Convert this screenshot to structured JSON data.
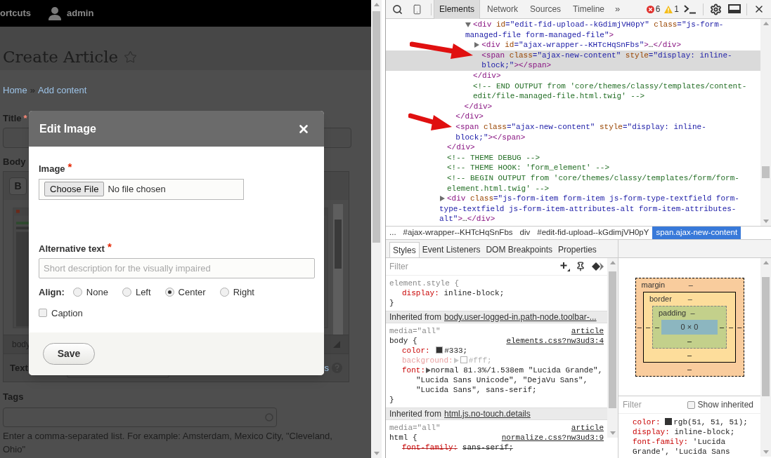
{
  "page": {
    "toolbar": {
      "shortcuts_label": "ortcuts",
      "user_name": "admin"
    },
    "title": "Create Article",
    "favorite": false,
    "breadcrumb": [
      {
        "label": "Home"
      },
      {
        "label": "Add content"
      }
    ],
    "breadcrumb_separator": "»",
    "title_field": {
      "label": "Title",
      "required_mark": "*"
    },
    "body_label": "Body",
    "editor": {
      "bold_button": "B",
      "path": "body"
    },
    "text_format": {
      "label": "Text",
      "link": "s"
    },
    "tags": {
      "label": "Tags",
      "help": "Enter a comma-separated list. For example: Amsterdam, Mexico City, \"Cleveland, Ohio\""
    }
  },
  "dialog": {
    "title": "Edit Image",
    "image": {
      "label": "Image",
      "required_mark": "*",
      "button": "Choose File",
      "status": "No file chosen"
    },
    "alt": {
      "label": "Alternative text",
      "required_mark": "*",
      "placeholder": "Short description for the visually impaired"
    },
    "align": {
      "label": "Align:",
      "options": [
        {
          "label": "None",
          "selected": false
        },
        {
          "label": "Left",
          "selected": false
        },
        {
          "label": "Center",
          "selected": true
        },
        {
          "label": "Right",
          "selected": false
        }
      ]
    },
    "caption": {
      "label": "Caption",
      "checked": false
    },
    "save": "Save"
  },
  "devtools": {
    "tabs": [
      {
        "label": "Elements",
        "selected": true
      },
      {
        "label": "Network",
        "selected": false
      },
      {
        "label": "Sources",
        "selected": false
      },
      {
        "label": "Timeline",
        "selected": false
      }
    ],
    "more": "»",
    "errors": "6",
    "warnings": "1",
    "dom_tree": [
      {
        "selected": false,
        "closing": [
          {
            "kind": "tag",
            "text": "</div>"
          }
        ],
        "children": [
          {
            "selected": false,
            "closing": [
              {
                "kind": "tag",
                "text": "</div>"
              }
            ],
            "children": [
              {
                "selected": false,
                "closing": [
                  {
                    "kind": "tag",
                    "text": "</div>"
                  }
                ],
                "children": [
                  {
                    "selected": false,
                    "expanded": true,
                    "lines": [
                      [
                        {
                          "kind": "tag",
                          "text": "<div"
                        },
                        {
                          "kind": "attr",
                          "text": " id"
                        },
                        {
                          "kind": "value",
                          "text": "=\"edit-fid-upload--kGdimjVH0pY\""
                        },
                        {
                          "kind": "attr",
                          "text": " class"
                        },
                        {
                          "kind": "value",
                          "text": "=\"js-form-"
                        }
                      ],
                      [
                        {
                          "kind": "value",
                          "text": "managed-file form-managed-file\""
                        },
                        {
                          "kind": "tag",
                          "text": ">"
                        }
                      ]
                    ],
                    "closing": [
                      {
                        "kind": "tag",
                        "text": "</div>"
                      }
                    ],
                    "children": [
                      {
                        "selected": false,
                        "expanded": false,
                        "lines": [
                          [
                            {
                              "kind": "tag",
                              "text": "<div"
                            },
                            {
                              "kind": "attr",
                              "text": " id"
                            },
                            {
                              "kind": "value",
                              "text": "=\"ajax-wrapper--KHTcHqSnFbs\""
                            },
                            {
                              "kind": "tag",
                              "text": ">"
                            },
                            {
                              "kind": "text",
                              "text": "…"
                            },
                            {
                              "kind": "tag",
                              "text": "</div>"
                            }
                          ]
                        ]
                      },
                      {
                        "selected": true,
                        "lines": [
                          [
                            {
                              "kind": "tag",
                              "text": "<span"
                            },
                            {
                              "kind": "attr",
                              "text": " class"
                            },
                            {
                              "kind": "value",
                              "text": "=\"ajax-new-content\""
                            },
                            {
                              "kind": "attr",
                              "text": " style"
                            },
                            {
                              "kind": "value",
                              "text": "=\"display: inline-"
                            }
                          ],
                          [
                            {
                              "kind": "value",
                              "text": "block;\""
                            },
                            {
                              "kind": "tag",
                              "text": "></span>"
                            }
                          ]
                        ]
                      }
                    ]
                  },
                  {
                    "selected": false,
                    "lines": [
                      [
                        {
                          "kind": "comment",
                          "text": "<!-- END OUTPUT from 'core/themes/classy/templates/content-"
                        }
                      ],
                      [
                        {
                          "kind": "comment",
                          "text": "edit/file-managed-file.html.twig' -->"
                        }
                      ]
                    ]
                  }
                ]
              }
            ]
          },
          {
            "selected": false,
            "lines": [
              [
                {
                  "kind": "tag",
                  "text": "<span"
                },
                {
                  "kind": "attr",
                  "text": " class"
                },
                {
                  "kind": "value",
                  "text": "=\"ajax-new-content\""
                },
                {
                  "kind": "attr",
                  "text": " style"
                },
                {
                  "kind": "value",
                  "text": "=\"display: inline-"
                }
              ],
              [
                {
                  "kind": "value",
                  "text": "block;\""
                },
                {
                  "kind": "tag",
                  "text": "></span>"
                }
              ]
            ]
          }
        ]
      },
      {
        "selected": false,
        "lines": [
          [
            {
              "kind": "comment",
              "text": "<!-- THEME DEBUG -->"
            }
          ]
        ]
      },
      {
        "selected": false,
        "lines": [
          [
            {
              "kind": "comment",
              "text": "<!-- THEME HOOK: 'form_element' -->"
            }
          ]
        ]
      },
      {
        "selected": false,
        "lines": [
          [
            {
              "kind": "comment",
              "text": "<!-- BEGIN OUTPUT from 'core/themes/classy/templates/form/form-"
            }
          ],
          [
            {
              "kind": "comment",
              "text": "element.html.twig' -->"
            }
          ]
        ]
      },
      {
        "selected": false,
        "expanded": false,
        "lines": [
          [
            {
              "kind": "tag",
              "text": "<div"
            },
            {
              "kind": "attr",
              "text": " class"
            },
            {
              "kind": "value",
              "text": "=\"js-form-item form-item js-form-type-textfield form-"
            }
          ],
          [
            {
              "kind": "value",
              "text": "type-textfield js-form-item-attributes-alt form-item-attributes-"
            }
          ],
          [
            {
              "kind": "value",
              "text": "alt\""
            },
            {
              "kind": "tag",
              "text": ">"
            },
            {
              "kind": "text",
              "text": "…"
            },
            {
              "kind": "tag",
              "text": "</div>"
            }
          ]
        ]
      }
    ],
    "breadcrumbs": [
      {
        "label": "...",
        "selected": false
      },
      {
        "label": "#ajax-wrapper--KHTcHqSnFbs",
        "selected": false
      },
      {
        "label": "div",
        "selected": false
      },
      {
        "label": "#edit-fid-upload--kGdimjVH0pY",
        "selected": false
      },
      {
        "label": "span.ajax-new-content",
        "selected": true
      }
    ],
    "sidebar_tabs": [
      {
        "label": "Styles",
        "selected": true
      },
      {
        "label": "Event Listeners",
        "selected": false
      },
      {
        "label": "DOM Breakpoints",
        "selected": false
      },
      {
        "label": "Properties",
        "selected": false
      }
    ],
    "styles_filter": {
      "placeholder": "Filter"
    },
    "style_sections": [
      {
        "kind": "rule",
        "selector": "element.style {",
        "closing": "}",
        "properties": [
          {
            "name": "display:",
            "value": "inline-block;",
            "kind": "active"
          }
        ]
      },
      {
        "kind": "inherited",
        "label": "Inherited from",
        "source": "body.user-logged-in.path-node.toolbar-..."
      },
      {
        "kind": "rule",
        "media": "media=\"all\"",
        "origin": "article",
        "selector": "body {",
        "source": "elements.css?nw3ud3:4",
        "closing": "}",
        "properties": [
          {
            "name": "color:",
            "color": "#333333",
            "value": "#333;",
            "kind": "active"
          },
          {
            "name": "background:",
            "expandable": true,
            "color": "#ffffff",
            "value": "#fff;",
            "kind": "inactive"
          },
          {
            "name": "font:",
            "expandable": true,
            "value": "normal 81.3%/1.538em \"Lucida Grande\", \"Lucida Sans Unicode\", \"DejaVu Sans\", \"Lucida Sans\", sans-serif;",
            "kind": "active"
          }
        ]
      },
      {
        "kind": "inherited",
        "label": "Inherited from",
        "source": "html.js.no-touch.details"
      },
      {
        "kind": "rule",
        "media": "media=\"all\"",
        "origin": "article",
        "selector": "html {",
        "source": "normalize.css?nw3ud3:9",
        "properties": [
          {
            "name": "font-family:",
            "value": "sans-serif;",
            "kind": "overridden"
          }
        ]
      }
    ],
    "box_model": {
      "layers": [
        {
          "label": "margin",
          "color": "#f9cc9d",
          "top": "–",
          "left": "–"
        },
        {
          "label": "border",
          "color": "#fddd9b",
          "top": "–",
          "left": "–"
        },
        {
          "label": "padding",
          "color": "#c3d08b",
          "top": "–",
          "left": "–"
        }
      ],
      "content": {
        "label": "0 × 0",
        "color": "#8cb6c0"
      },
      "right_values": [
        "–",
        "–",
        "–"
      ],
      "bottom_values": [
        "–",
        "–",
        "–"
      ]
    },
    "computed_filter": {
      "placeholder": "Filter"
    },
    "show_inherited": {
      "label": "Show inherited",
      "checked": false
    },
    "computed": [
      {
        "name": "color:",
        "color": "#333333",
        "value": "rgb(51, 51, 51);"
      },
      {
        "name": "display:",
        "value": "inline-block;"
      },
      {
        "name": "font-family:",
        "value": "'Lucida Grande', 'Lucida Sans"
      }
    ]
  }
}
